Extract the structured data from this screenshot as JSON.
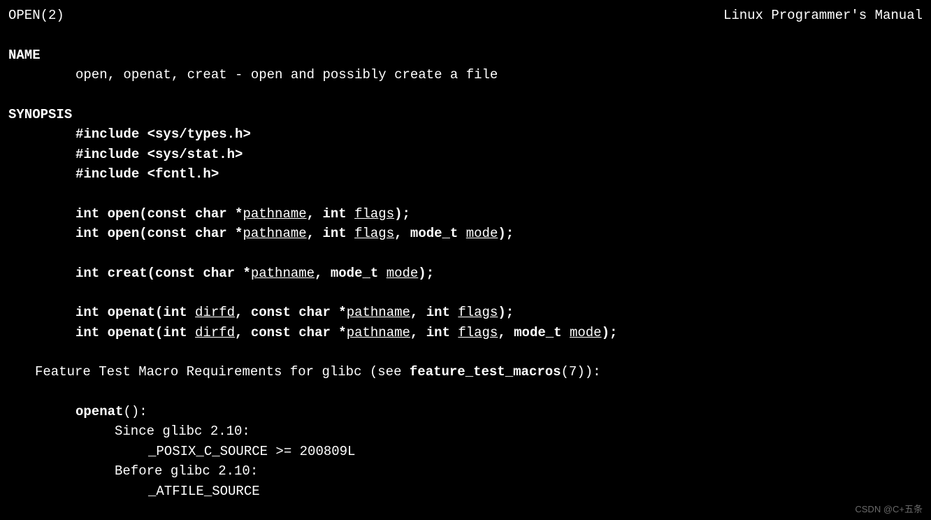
{
  "header": {
    "left": "OPEN(2)",
    "right": "Linux Programmer's Manual"
  },
  "name_section": {
    "heading": "NAME",
    "line": "open, openat, creat - open and possibly create a file"
  },
  "synopsis": {
    "heading": "SYNOPSIS",
    "includes": {
      "inc1_pre": "#include <sys/types.h>",
      "inc2_pre": "#include <sys/stat.h>",
      "inc3_pre": "#include <fcntl.h>"
    },
    "sig1": {
      "p1": "int open(const char *",
      "pathname": "pathname",
      "p2": ", int ",
      "flags": "flags",
      "p3": ");"
    },
    "sig2": {
      "p1": "int open(const char *",
      "pathname": "pathname",
      "p2": ", int ",
      "flags": "flags",
      "p3": ", mode_t ",
      "mode": "mode",
      "p4": ");"
    },
    "sig3": {
      "p1": "int creat(const char *",
      "pathname": "pathname",
      "p2": ", mode_t ",
      "mode": "mode",
      "p3": ");"
    },
    "sig4": {
      "p1": "int openat(int ",
      "dirfd": "dirfd",
      "p2": ", const char *",
      "pathname": "pathname",
      "p3": ", int ",
      "flags": "flags",
      "p4": ");"
    },
    "sig5": {
      "p1": "int openat(int ",
      "dirfd": "dirfd",
      "p2": ", const char *",
      "pathname": "pathname",
      "p3": ", int ",
      "flags": "flags",
      "p4": ", mode_t ",
      "mode": "mode",
      "p5": ");"
    }
  },
  "ftm": {
    "intro_pre": "Feature Test Macro Requirements for glibc (see ",
    "intro_bold": "feature_test_macros",
    "intro_post": "(7)):",
    "openat_label": "openat",
    "openat_paren": "():",
    "since": "Since glibc 2.10:",
    "since_val": "_POSIX_C_SOURCE >= 200809L",
    "before": "Before glibc 2.10:",
    "before_val": "_ATFILE_SOURCE"
  },
  "watermark": "CSDN @C+五条"
}
